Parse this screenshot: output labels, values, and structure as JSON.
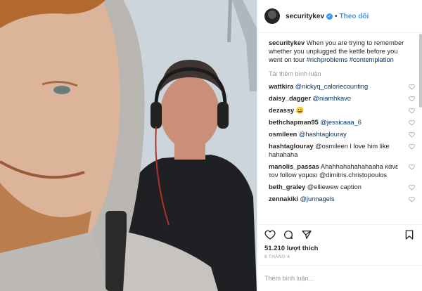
{
  "header": {
    "username": "securitykev",
    "separator": "•",
    "follow_label": "Theo dõi"
  },
  "caption": {
    "username": "securitykev",
    "text": "When you are trying to remember whether you unplugged the kettle before you went on tour",
    "tags": "#richproblems #contemplation"
  },
  "load_more_label": "Tải thêm bình luận",
  "comments": [
    {
      "user": "wattkira",
      "text": "@nickyq_caloriecounting"
    },
    {
      "user": "daisy_dagger",
      "text": "@niamhkavo"
    },
    {
      "user": "dezassy",
      "text": "😀"
    },
    {
      "user": "bethchapman95",
      "text": "@jessicaaa_6"
    },
    {
      "user": "osmileen",
      "text": "@hashtaglouray"
    },
    {
      "user": "hashtaglouray",
      "text": "@osmileen I love him like hahahaha"
    },
    {
      "user": "manolis_passas",
      "text": "Ahahhahahahahaaha κάνε τον follow γαμαει @dimitris.christopoulos"
    },
    {
      "user": "beth_graley",
      "text": "@elliewew caption"
    },
    {
      "user": "zennakiki",
      "text": "@junnagels"
    }
  ],
  "likes": "51.210 lượt thích",
  "date": "8 THÁNG 4",
  "add_comment_placeholder": "Thêm bình luận...",
  "colors": {
    "link": "#003569",
    "accent": "#3897f0",
    "muted": "#999999"
  },
  "icons": [
    "heart-icon",
    "comment-icon",
    "share-icon",
    "bookmark-icon",
    "verified-badge-icon"
  ]
}
